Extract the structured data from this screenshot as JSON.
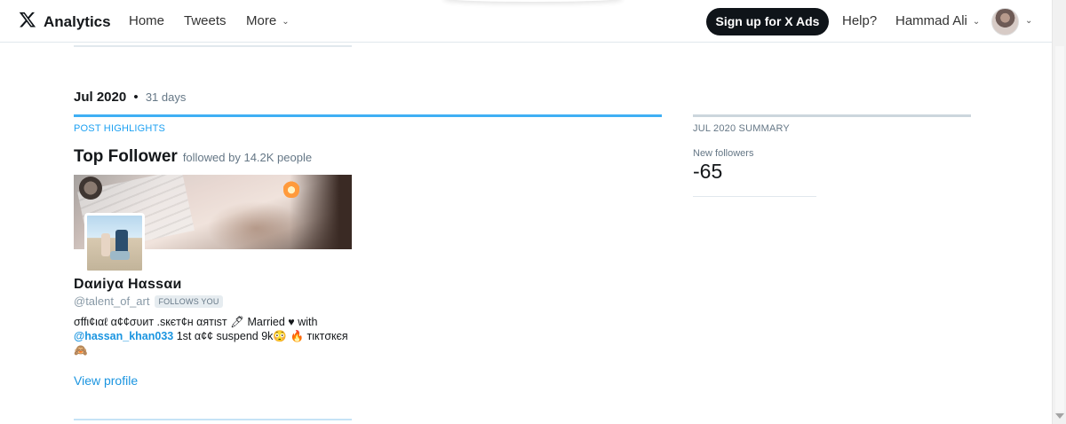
{
  "nav": {
    "brand": "Analytics",
    "home": "Home",
    "tweets": "Tweets",
    "more": "More",
    "signup": "Sign up for X Ads",
    "help": "Help?",
    "user_name": "Hammad Ali"
  },
  "period": {
    "month": "Jul 2020",
    "separator": "•",
    "days": "31 days"
  },
  "highlights": {
    "section_label": "POST HIGHLIGHTS",
    "title": "Top Follower",
    "subtitle": "followed by 14.2K people",
    "follower": {
      "display_name": "Dαиiуα Hαssαи",
      "handle": "@talent_of_art",
      "follows_badge": "FOLLOWS YOU",
      "bio_part1": "σffι¢ιαℓ α¢¢συит .ѕкєт¢н αятιѕт 🖊 Married ♥ with",
      "bio_mention": "@hassan_khan033",
      "bio_part2": " 1st α¢¢ suspend 9k😳  🔥 тιктσкєя",
      "bio_part3": "🙈",
      "view_profile": "View profile"
    }
  },
  "summary": {
    "section_label": "JUL 2020 SUMMARY",
    "new_followers_label": "New followers",
    "new_followers_value": "-65"
  },
  "colors": {
    "accent": "#1da1f2",
    "link": "#1b95e0",
    "button_bg": "#0f1419"
  },
  "icons": {
    "logo": "x-logo-icon",
    "chevron": "chevron-down-icon"
  }
}
